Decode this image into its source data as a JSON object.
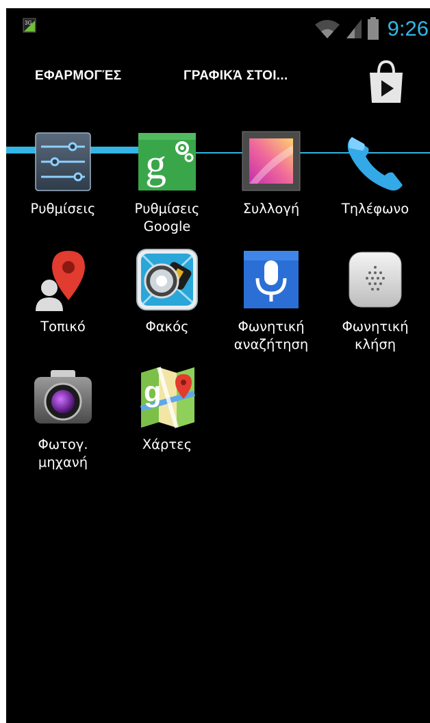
{
  "status_bar": {
    "network_icon": "3g-data-icon",
    "wifi_icon": "wifi-icon",
    "signal_icon": "cell-signal-icon",
    "battery_icon": "battery-icon",
    "time": "9:26",
    "accent_color": "#33b5e5"
  },
  "tabs": {
    "apps_label": "ΕΦΑΡΜΟΓΈΣ",
    "widgets_label": "ΓΡΑΦΙΚΆ ΣΤΟΙ...",
    "active": "apps",
    "store_icon": "play-store-bag-icon"
  },
  "apps": [
    {
      "label": "Ρυθμίσεις",
      "icon": "settings-icon"
    },
    {
      "label": "Ρυθμίσεις\nGoogle",
      "icon": "google-settings-icon"
    },
    {
      "label": "Συλλογή",
      "icon": "gallery-icon"
    },
    {
      "label": "Τηλέφωνο",
      "icon": "phone-icon"
    },
    {
      "label": "Τοπικό",
      "icon": "local-icon"
    },
    {
      "label": "Φακός",
      "icon": "flashlight-icon"
    },
    {
      "label": "Φωνητική\nαναζήτηση",
      "icon": "voice-search-icon"
    },
    {
      "label": "Φωνητική\nκλήση",
      "icon": "voice-dialer-icon"
    },
    {
      "label": "Φωτογ.\nμηχανή",
      "icon": "camera-icon"
    },
    {
      "label": "Χάρτες",
      "icon": "maps-icon"
    }
  ]
}
